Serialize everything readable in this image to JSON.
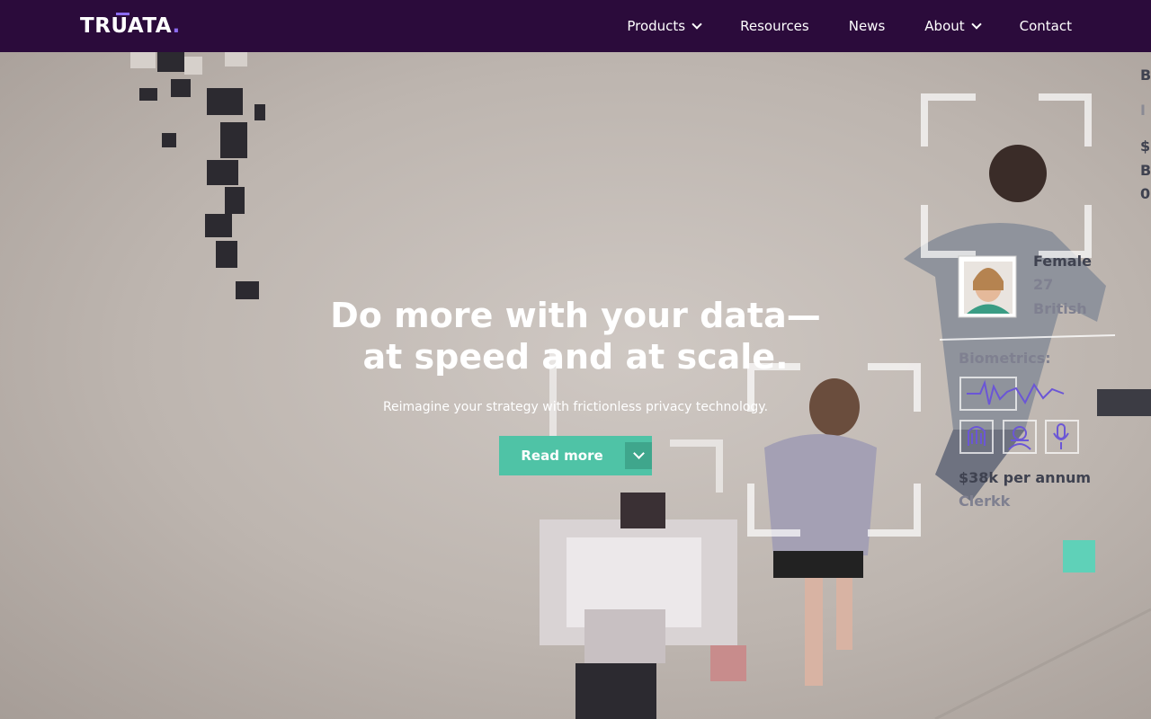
{
  "header": {
    "logo": "TRUATA",
    "logo_dot": ".",
    "nav": [
      {
        "label": "Products",
        "has_dropdown": true
      },
      {
        "label": "Resources",
        "has_dropdown": false
      },
      {
        "label": "News",
        "has_dropdown": false
      },
      {
        "label": "About",
        "has_dropdown": true
      },
      {
        "label": "Contact",
        "has_dropdown": false
      }
    ]
  },
  "hero": {
    "title_line1": "Do more with your data—",
    "title_line2": "at speed and at scale.",
    "subtitle": "Reimagine your strategy with frictionless privacy technology.",
    "cta_label": "Read more"
  },
  "overlay": {
    "gender": "Female",
    "age": "27",
    "nationality": "British",
    "biometrics_label": "Biometrics:",
    "income": "$38k per annum",
    "location": "Clerkk",
    "edge_chars": [
      "B",
      "I",
      "$",
      "B",
      "0"
    ]
  },
  "colors": {
    "nav_bg": "#2b0b3b",
    "accent": "#8c6cf0",
    "cta": "#4fc3a6"
  }
}
